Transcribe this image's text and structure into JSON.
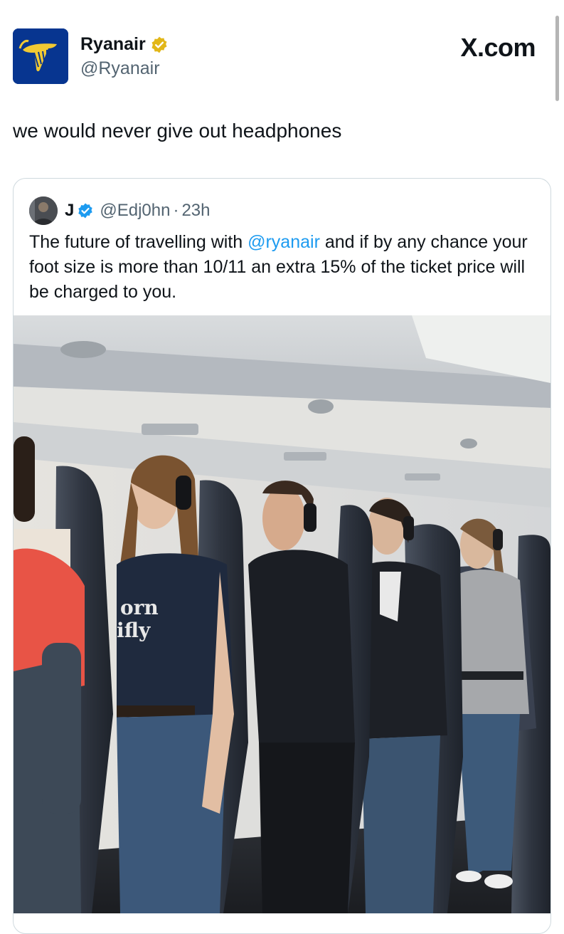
{
  "post": {
    "author_name": "Ryanair",
    "author_handle": "@Ryanair",
    "site": "X.com",
    "text": "we would never give out headphones",
    "avatar_icon": "ryanair-harp-logo-icon",
    "badge_icon": "gold-verified-badge-icon"
  },
  "quote": {
    "name": "J",
    "handle": "@Edj0hn",
    "separator": "·",
    "time": "23h",
    "text_before": "The  future of travelling with ",
    "mention": "@ryanair",
    "text_after": " and if by any chance your foot  size is more than 10/11  an extra 15% of the ticket price will be charged to you.",
    "badge_icon": "blue-verified-badge-icon",
    "image_shirt_text_line1": "orn",
    "image_shirt_text_line2": "ifly"
  },
  "colors": {
    "ryanair_blue": "#073590",
    "ryanair_gold": "#f1c933",
    "link_blue": "#1d9bf0",
    "secondary_text": "#536471"
  }
}
